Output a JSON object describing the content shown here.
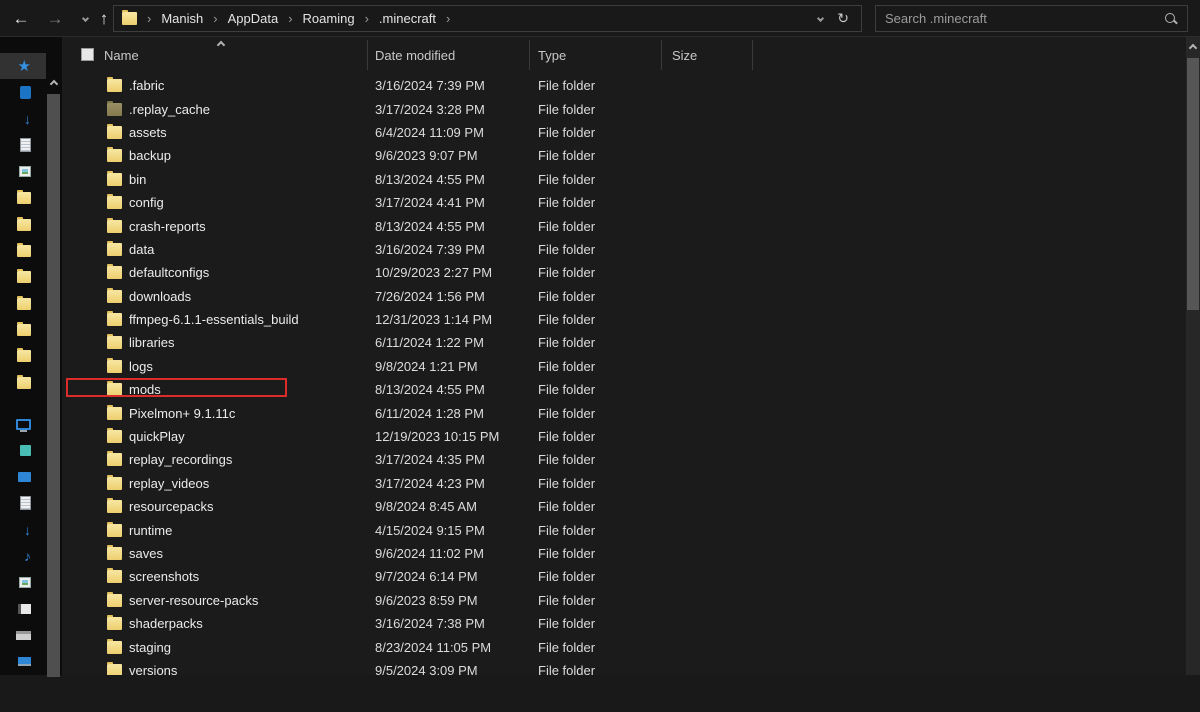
{
  "toolbar": {
    "back_icon": "←",
    "forward_icon": "→",
    "up_icon": "↑",
    "refresh_icon": "↻",
    "breadcrumb_separator": "›"
  },
  "address_bar": {
    "breadcrumbs": [
      "Manish",
      "AppData",
      "Roaming",
      ".minecraft"
    ]
  },
  "search": {
    "placeholder": "Search .minecraft"
  },
  "columns": {
    "name": "Name",
    "date": "Date modified",
    "type": "Type",
    "size": "Size"
  },
  "sort": {
    "column": "Name",
    "direction": "ascending"
  },
  "files": [
    {
      "name": ".fabric",
      "date": "3/16/2024 7:39 PM",
      "type": "File folder"
    },
    {
      "name": ".replay_cache",
      "date": "3/17/2024 3:28 PM",
      "type": "File folder",
      "hidden": true
    },
    {
      "name": "assets",
      "date": "6/4/2024 11:09 PM",
      "type": "File folder"
    },
    {
      "name": "backup",
      "date": "9/6/2023 9:07 PM",
      "type": "File folder"
    },
    {
      "name": "bin",
      "date": "8/13/2024 4:55 PM",
      "type": "File folder"
    },
    {
      "name": "config",
      "date": "3/17/2024 4:41 PM",
      "type": "File folder"
    },
    {
      "name": "crash-reports",
      "date": "8/13/2024 4:55 PM",
      "type": "File folder"
    },
    {
      "name": "data",
      "date": "3/16/2024 7:39 PM",
      "type": "File folder"
    },
    {
      "name": "defaultconfigs",
      "date": "10/29/2023 2:27 PM",
      "type": "File folder"
    },
    {
      "name": "downloads",
      "date": "7/26/2024 1:56 PM",
      "type": "File folder"
    },
    {
      "name": "ffmpeg-6.1.1-essentials_build",
      "date": "12/31/2023 1:14 PM",
      "type": "File folder"
    },
    {
      "name": "libraries",
      "date": "6/11/2024 1:22 PM",
      "type": "File folder"
    },
    {
      "name": "logs",
      "date": "9/8/2024 1:21 PM",
      "type": "File folder"
    },
    {
      "name": "mods",
      "date": "8/13/2024 4:55 PM",
      "type": "File folder",
      "highlighted": true
    },
    {
      "name": "Pixelmon+ 9.1.11c",
      "date": "6/11/2024 1:28 PM",
      "type": "File folder"
    },
    {
      "name": "quickPlay",
      "date": "12/19/2023 10:15 PM",
      "type": "File folder"
    },
    {
      "name": "replay_recordings",
      "date": "3/17/2024 4:35 PM",
      "type": "File folder"
    },
    {
      "name": "replay_videos",
      "date": "3/17/2024 4:23 PM",
      "type": "File folder"
    },
    {
      "name": "resourcepacks",
      "date": "9/8/2024 8:45 AM",
      "type": "File folder"
    },
    {
      "name": "runtime",
      "date": "4/15/2024 9:15 PM",
      "type": "File folder"
    },
    {
      "name": "saves",
      "date": "9/6/2024 11:02 PM",
      "type": "File folder"
    },
    {
      "name": "screenshots",
      "date": "9/7/2024 6:14 PM",
      "type": "File folder"
    },
    {
      "name": "server-resource-packs",
      "date": "9/6/2023 8:59 PM",
      "type": "File folder"
    },
    {
      "name": "shaderpacks",
      "date": "3/16/2024 7:38 PM",
      "type": "File folder"
    },
    {
      "name": "staging",
      "date": "8/23/2024 11:05 PM",
      "type": "File folder"
    },
    {
      "name": "versions",
      "date": "9/5/2024 3:09 PM",
      "type": "File folder"
    }
  ],
  "sidebar": {
    "quick_access_items": [
      {
        "name": "quick-access-star-icon",
        "kind": "star",
        "highlighted": true
      },
      {
        "name": "onedrive-icon",
        "kind": "square"
      },
      {
        "name": "downloads-pin-icon",
        "kind": "arrow"
      },
      {
        "name": "documents-pin-icon",
        "kind": "doc"
      },
      {
        "name": "pictures-pin-icon",
        "kind": "pic"
      },
      {
        "name": "pinned-folder-icon",
        "kind": "folder"
      },
      {
        "name": "pinned-folder-icon",
        "kind": "folder"
      },
      {
        "name": "pinned-folder-icon",
        "kind": "folder"
      },
      {
        "name": "pinned-folder-icon",
        "kind": "folder"
      },
      {
        "name": "pinned-folder-icon",
        "kind": "folder"
      },
      {
        "name": "pinned-folder-icon",
        "kind": "folder"
      },
      {
        "name": "pinned-folder-icon",
        "kind": "folder"
      },
      {
        "name": "pinned-folder-icon",
        "kind": "folder"
      }
    ],
    "this_pc_items": [
      {
        "name": "this-pc-icon",
        "kind": "monitor"
      },
      {
        "name": "3d-objects-icon",
        "kind": "cube"
      },
      {
        "name": "desktop-icon",
        "kind": "desktop"
      },
      {
        "name": "documents-icon",
        "kind": "doc"
      },
      {
        "name": "downloads-icon",
        "kind": "arrow"
      },
      {
        "name": "music-icon",
        "kind": "music"
      },
      {
        "name": "pictures-icon",
        "kind": "pic"
      },
      {
        "name": "videos-icon",
        "kind": "video"
      },
      {
        "name": "local-disk-icon",
        "kind": "disk"
      },
      {
        "name": "network-icon",
        "kind": "network"
      }
    ]
  },
  "colors": {
    "folder_yellow": "#edce6d",
    "hidden_folder_olive": "#857a4e",
    "annotation_red": "#dc2b2b",
    "accent_blue": "#2f86d6",
    "background": "#191919"
  }
}
